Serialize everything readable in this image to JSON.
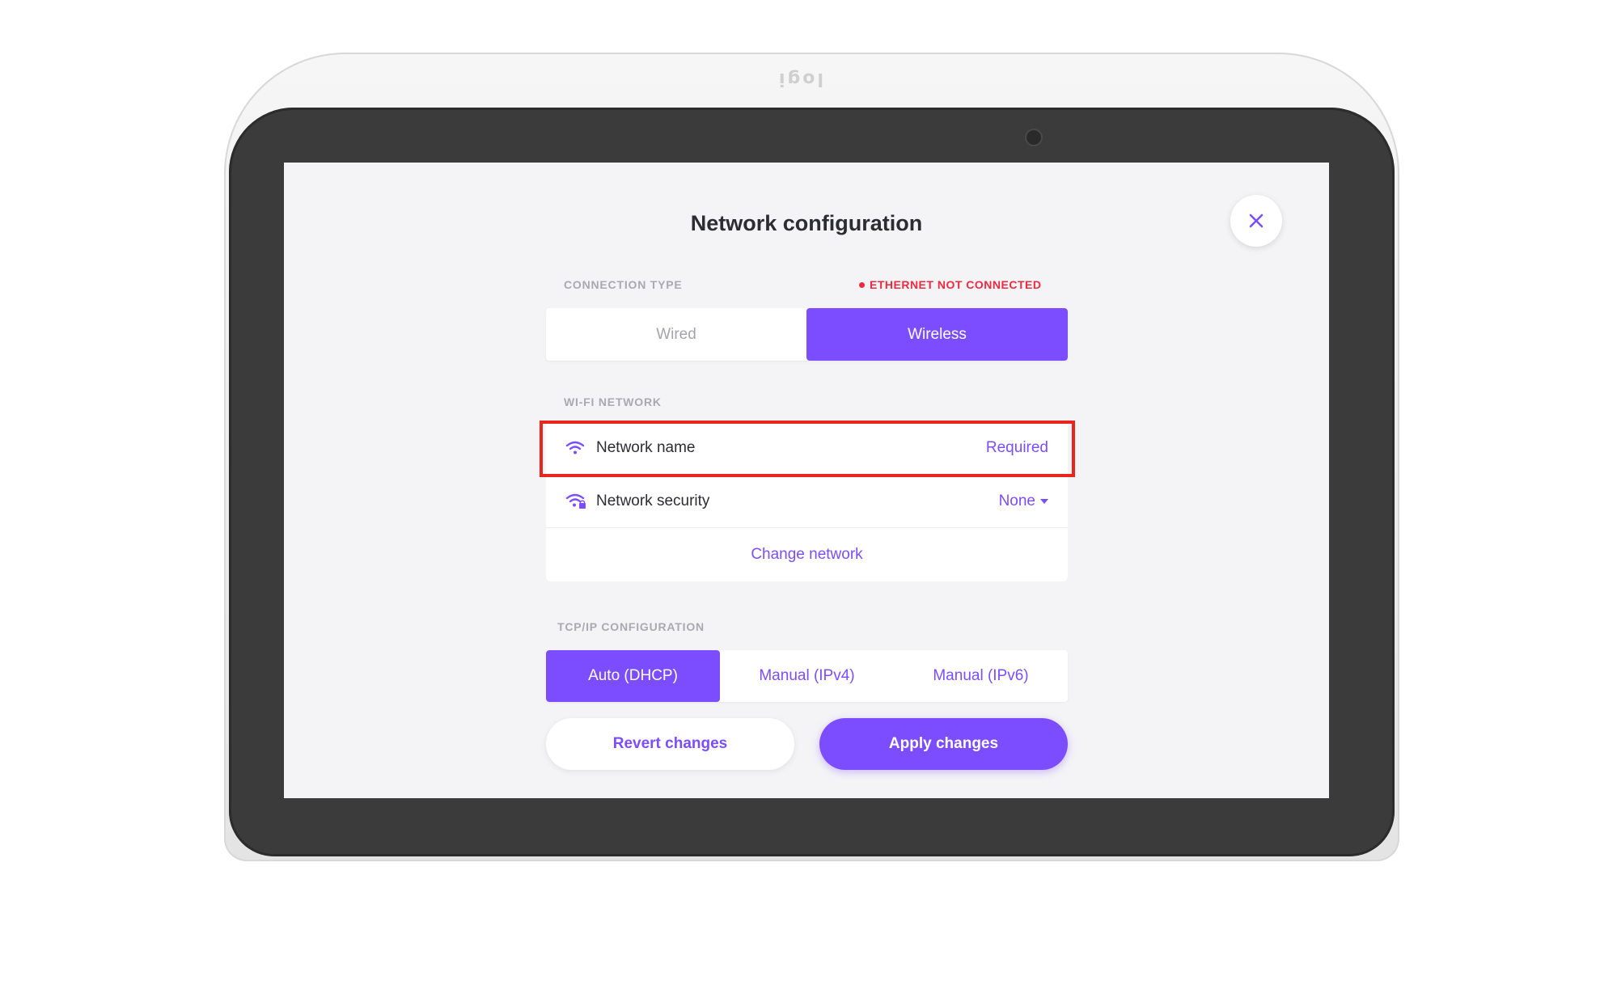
{
  "device": {
    "brand_mark": "logi"
  },
  "screen": {
    "title": "Network configuration",
    "close_icon": "close-icon",
    "connection": {
      "label": "CONNECTION TYPE",
      "status": "ETHERNET NOT CONNECTED",
      "status_color": "#ee2a3f",
      "options": [
        "Wired",
        "Wireless"
      ],
      "selected": "Wireless"
    },
    "wifi": {
      "label": "WI-FI NETWORK",
      "network_name": {
        "label": "Network name",
        "value": "Required",
        "icon": "wifi-icon"
      },
      "network_security": {
        "label": "Network security",
        "value": "None",
        "icon": "wifi-lock-icon",
        "dropdown_icon": "caret-down-icon"
      },
      "change_network": "Change network"
    },
    "tcpip": {
      "label": "TCP/IP CONFIGURATION",
      "options": [
        "Auto (DHCP)",
        "Manual (IPv4)",
        "Manual (IPv6)"
      ],
      "selected": "Auto (DHCP)"
    },
    "buttons": {
      "revert": "Revert changes",
      "apply": "Apply changes"
    },
    "accent_color": "#7c4dff"
  }
}
